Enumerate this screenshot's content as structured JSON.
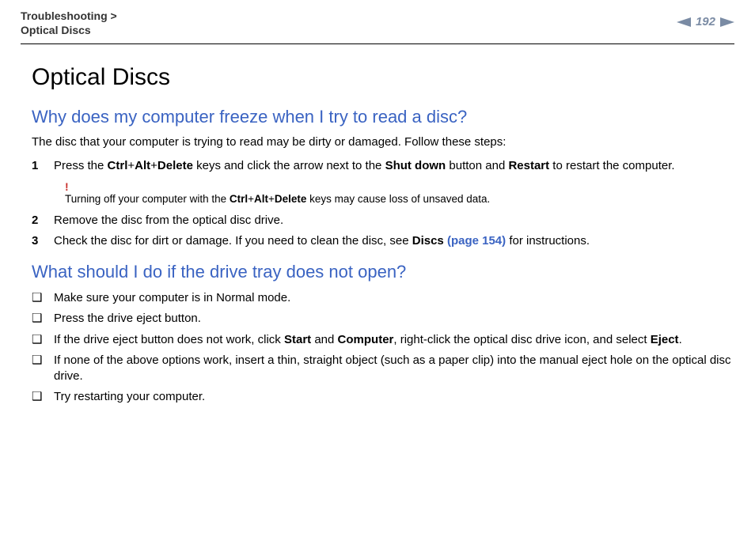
{
  "header": {
    "breadcrumb": {
      "parent": "Troubleshooting",
      "sep": ">",
      "child": "Optical Discs"
    },
    "page_number": "192"
  },
  "title": "Optical Discs",
  "sections": [
    {
      "heading": "Why does my computer freeze when I try to read a disc?",
      "intro": "The disc that your computer is trying to read may be dirty or damaged. Follow these steps:",
      "steps": [
        {
          "n": "1",
          "parts": [
            {
              "t": "Press the "
            },
            {
              "t": "Ctrl",
              "b": true
            },
            {
              "t": "+"
            },
            {
              "t": "Alt",
              "b": true
            },
            {
              "t": "+"
            },
            {
              "t": "Delete",
              "b": true
            },
            {
              "t": " keys and click the arrow next to the "
            },
            {
              "t": "Shut down",
              "b": true
            },
            {
              "t": " button and "
            },
            {
              "t": "Restart",
              "b": true
            },
            {
              "t": " to restart the computer."
            }
          ],
          "warning": {
            "bang": "!",
            "parts": [
              {
                "t": "Turning off your computer with the "
              },
              {
                "t": "Ctrl",
                "b": true
              },
              {
                "t": "+"
              },
              {
                "t": "Alt",
                "b": true
              },
              {
                "t": "+"
              },
              {
                "t": "Delete",
                "b": true
              },
              {
                "t": " keys may cause loss of unsaved data."
              }
            ]
          }
        },
        {
          "n": "2",
          "parts": [
            {
              "t": "Remove the disc from the optical disc drive."
            }
          ]
        },
        {
          "n": "3",
          "parts": [
            {
              "t": "Check the disc for dirt or damage. If you need to clean the disc, see "
            },
            {
              "t": "Discs ",
              "b": true
            },
            {
              "t": "(page 154)",
              "link": true
            },
            {
              "t": " for instructions."
            }
          ]
        }
      ]
    },
    {
      "heading": "What should I do if the drive tray does not open?",
      "bullets": [
        {
          "parts": [
            {
              "t": "Make sure your computer is in Normal mode."
            }
          ]
        },
        {
          "parts": [
            {
              "t": "Press the drive eject button."
            }
          ]
        },
        {
          "parts": [
            {
              "t": "If the drive eject button does not work, click "
            },
            {
              "t": "Start",
              "b": true
            },
            {
              "t": " and "
            },
            {
              "t": "Computer",
              "b": true
            },
            {
              "t": ", right-click the optical disc drive icon, and select "
            },
            {
              "t": "Eject",
              "b": true
            },
            {
              "t": "."
            }
          ]
        },
        {
          "parts": [
            {
              "t": "If none of the above options work, insert a thin, straight object (such as a paper clip) into the manual eject hole on the optical disc drive."
            }
          ]
        },
        {
          "parts": [
            {
              "t": "Try restarting your computer."
            }
          ]
        }
      ]
    }
  ],
  "glyphs": {
    "square_bullet": "❑"
  }
}
